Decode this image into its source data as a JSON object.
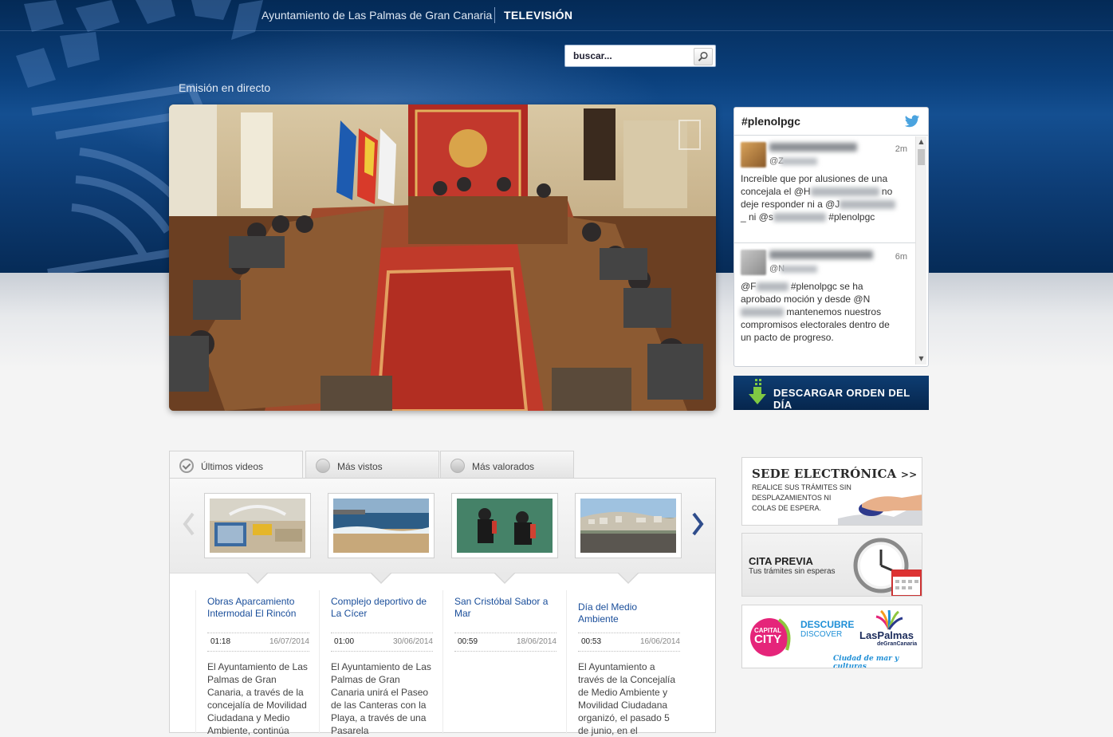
{
  "header": {
    "site_title": "Ayuntamiento de Las Palmas de Gran Canaria",
    "section_title": "TELEVISIÓN"
  },
  "search": {
    "placeholder": "buscar..."
  },
  "live": {
    "label": "Emisión en directo"
  },
  "twitter": {
    "hashtag": "#plenolpgc",
    "tweets": [
      {
        "time": "2m",
        "handle_prefix": "@Z",
        "text_1": "Increíble que por alusiones de una concejala  el @H",
        "text_2": " no deje responder ni a @J",
        "text_3": "_ ni @s",
        "text_4": " #plenolpgc"
      },
      {
        "time": "6m",
        "handle_prefix": "@N",
        "text_1": "@F",
        "text_2": " #plenolpgc se ha aprobado moción y desde @N",
        "text_3": " mantenemos nuestros compromisos electorales dentro de un pacto de progreso."
      }
    ]
  },
  "download": {
    "label": "DESCARGAR ORDEN DEL DÍA"
  },
  "tabs": [
    {
      "label": "Últimos videos",
      "active": true
    },
    {
      "label": "Más vistos",
      "active": false
    },
    {
      "label": "Más valorados",
      "active": false
    }
  ],
  "videos": [
    {
      "title": "Obras Aparcamiento Intermodal El Rincón",
      "duration": "01:18",
      "date": "16/07/2014",
      "description": "El Ayuntamiento de Las Palmas de Gran Canaria, a través de la concejalía de Movilidad Ciudadana y Medio Ambiente, continúa"
    },
    {
      "title": "Complejo deportivo de La Cícer",
      "duration": "01:00",
      "date": "30/06/2014",
      "description": "El Ayuntamiento de Las Palmas de Gran Canaria unirá el Paseo de las Canteras con la Playa, a través de una Pasarela"
    },
    {
      "title": "San Cristóbal Sabor a Mar",
      "duration": "00:59",
      "date": "18/06/2014",
      "description": ""
    },
    {
      "title": "Día del Medio Ambiente",
      "duration": "00:53",
      "date": "16/06/2014",
      "description": "El Ayuntamiento a través de la Concejalía de Medio Ambiente y Movilidad Ciudadana organizó, el pasado 5 de junio, en el"
    }
  ],
  "banners": {
    "sede": {
      "title": "SEDE ELECTRÓNICA",
      "arrows": ">>",
      "subtitle": "Realice sus trámites sin desplazamientos ni colas de espera."
    },
    "cita": {
      "title": "CITA PREVIA",
      "subtitle": "Tus trámites sin esperas"
    },
    "capital": {
      "badge_1": "CAPITAL",
      "badge_2": "CITY",
      "line_1": "DESCUBRE",
      "line_2": "DISCOVER",
      "brand_1": "LasPalmas",
      "brand_2": "deGranCanaria",
      "tagline": "Ciudad de mar y culturas"
    }
  }
}
